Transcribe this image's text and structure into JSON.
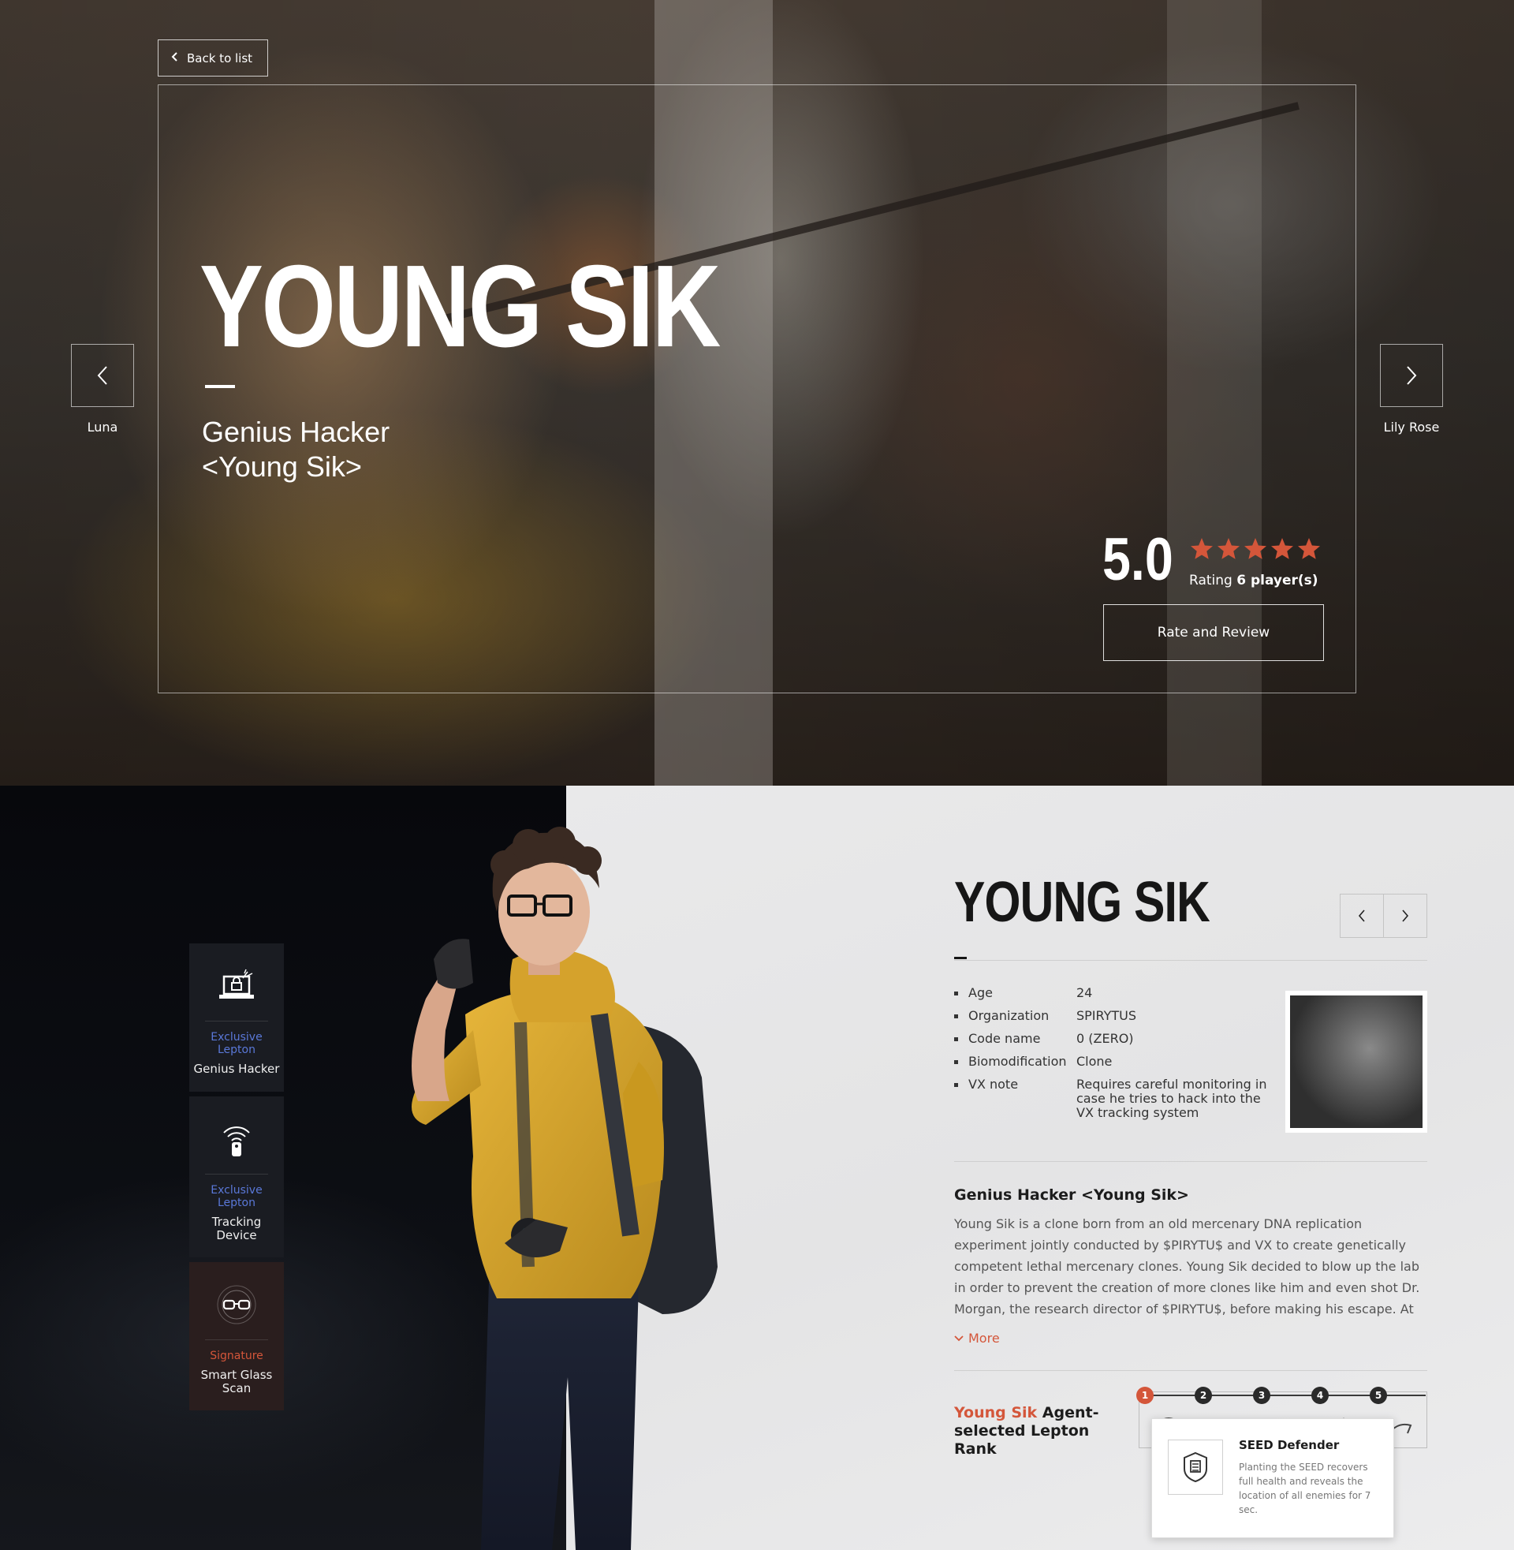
{
  "hero": {
    "back_label": "Back to list",
    "title": "YOUNG SIK",
    "subtitle_line1": "Genius Hacker",
    "subtitle_line2": "<Young Sik>",
    "prev_character": "Luna",
    "next_character": "Lily Rose",
    "rating": {
      "score": "5.0",
      "stars": 5,
      "max_stars": 5,
      "label": "Rating",
      "players": "6 player(s)"
    },
    "rate_button": "Rate and Review"
  },
  "skills": [
    {
      "type": "Exclusive Lepton",
      "name": "Genius Hacker",
      "icon": "laptop-hack-icon"
    },
    {
      "type": "Exclusive Lepton",
      "name": "Tracking Device",
      "icon": "tracking-device-icon"
    },
    {
      "type": "Signature",
      "name": "Smart Glass Scan",
      "icon": "smart-glass-icon"
    }
  ],
  "info": {
    "title": "YOUNG SIK",
    "attributes": [
      {
        "key": "Age",
        "value": "24"
      },
      {
        "key": "Organization",
        "value": "SPIRYTUS"
      },
      {
        "key": "Code name",
        "value": "0 (ZERO)"
      },
      {
        "key": "Biomodification",
        "value": "Clone"
      },
      {
        "key": "VX note",
        "value": "Requires careful monitoring in case he tries to hack into the VX tracking system"
      }
    ],
    "bio_title": "Genius Hacker <Young Sik>",
    "bio_text": "Young Sik is a clone born from an old mercenary DNA replication experiment jointly conducted by $PIRYTU$ and VX to create genetically competent lethal mercenary clones. Young Sik decided to blow up the lab in order to prevent the creation of more clones like him and even shot Dr. Morgan, the research director of $PIRYTU$, before making his escape. At first, it seemed that Young Sik's plan",
    "more_label": "More",
    "rank": {
      "title_highlight": "Young Sik",
      "title_rest": " Agent-selected Lepton Rank",
      "steps": [
        "1",
        "2",
        "3",
        "4",
        "5"
      ],
      "active_step": "1",
      "tooltip_name": "SEED Defender",
      "tooltip_desc": "Planting the SEED recovers full health and reveals the location of all enemies for 7 sec."
    }
  },
  "colors": {
    "accent": "#d4563a",
    "lepton_blue": "#5a78d8",
    "star": "#d4563a"
  }
}
